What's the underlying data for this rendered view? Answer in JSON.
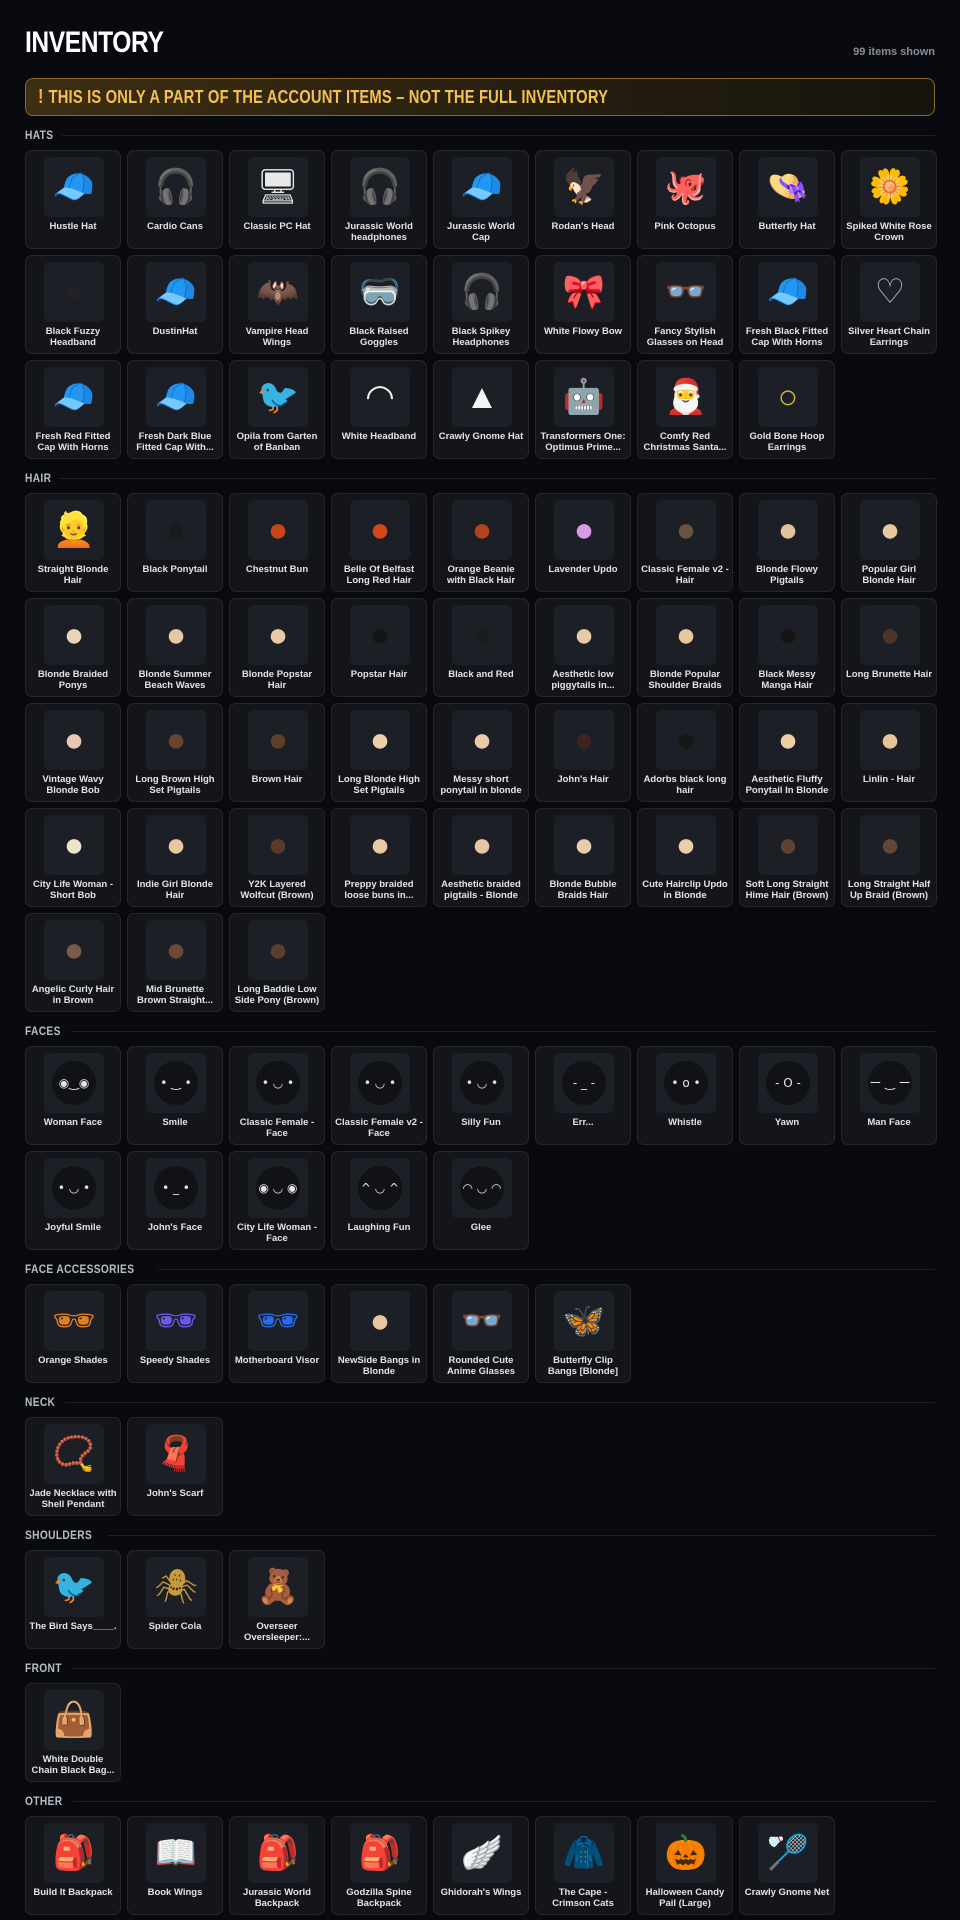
{
  "header": {
    "title": "INVENTORY",
    "count": "99 items shown",
    "warning": "THIS IS ONLY A PART OF THE ACCOUNT ITEMS – NOT THE FULL INVENTORY"
  },
  "colors": {
    "background": "#090a0f",
    "card": "#13151b",
    "accent": "#f4c04f"
  },
  "sections": [
    {
      "title": "HATS",
      "items": [
        {
          "label": "Hustle Hat",
          "glyph": "🧢",
          "color": "#2a2a2a"
        },
        {
          "label": "Cardio Cans",
          "glyph": "🎧",
          "color": "#9a32d6"
        },
        {
          "label": "Classic PC Hat",
          "glyph": "🖥",
          "color": "#e8e8e8"
        },
        {
          "label": "Jurassic World headphones",
          "glyph": "🎧",
          "color": "#3a3a3a"
        },
        {
          "label": "Jurassic World Cap",
          "glyph": "🧢",
          "color": "#2e2e2e"
        },
        {
          "label": "Rodan's Head",
          "glyph": "🦅",
          "color": "#6a1f2c"
        },
        {
          "label": "Pink Octopus",
          "glyph": "🐙",
          "color": "#f2a9c9"
        },
        {
          "label": "Butterfly Hat",
          "glyph": "👒",
          "color": "#f2f2f2"
        },
        {
          "label": "Spiked White Rose Crown",
          "glyph": "🌼",
          "color": "#f0f0f0"
        },
        {
          "label": "Black Fuzzy Headband",
          "glyph": "●",
          "color": "#222222"
        },
        {
          "label": "DustinHat",
          "glyph": "🧢",
          "color": "#e04444"
        },
        {
          "label": "Vampire Head Wings",
          "glyph": "🦇",
          "color": "#b32020"
        },
        {
          "label": "Black Raised Goggles",
          "glyph": "🥽",
          "color": "#2a2a2a"
        },
        {
          "label": "Black Spikey Headphones",
          "glyph": "🎧",
          "color": "#3a3a3a"
        },
        {
          "label": "White Flowy Bow",
          "glyph": "🎀",
          "color": "#f4f4f4"
        },
        {
          "label": "Fancy Stylish Glasses on Head",
          "glyph": "👓",
          "color": "#c8c8c8"
        },
        {
          "label": "Fresh Black Fitted Cap With Horns",
          "glyph": "🧢",
          "color": "#1e1e1e"
        },
        {
          "label": "Silver Heart Chain Earrings",
          "glyph": "♡",
          "color": "#b8b8b8"
        },
        {
          "label": "Fresh Red Fitted Cap With Horns",
          "glyph": "🧢",
          "color": "#d8293a"
        },
        {
          "label": "Fresh Dark Blue Fitted Cap With...",
          "glyph": "🧢",
          "color": "#1f2f7a"
        },
        {
          "label": "Opila from Garten of Banban",
          "glyph": "🐦",
          "color": "#d36ac2"
        },
        {
          "label": "White Headband",
          "glyph": "◠",
          "color": "#f0f0f0"
        },
        {
          "label": "Crawly Gnome Hat",
          "glyph": "▲",
          "color": "#f4f4f4"
        },
        {
          "label": "Transformers One: Optimus Prime...",
          "glyph": "🤖",
          "color": "#1f3c8f"
        },
        {
          "label": "Comfy Red Christmas Santa...",
          "glyph": "🎅",
          "color": "#d62b2b"
        },
        {
          "label": "Gold Bone Hoop Earrings",
          "glyph": "○",
          "color": "#d4ae3e"
        }
      ]
    },
    {
      "title": "HAIR",
      "items": [
        {
          "label": "Straight Blonde Hair",
          "glyph": "👱",
          "color": "#d8b33a"
        },
        {
          "label": "Black Ponytail",
          "glyph": "●",
          "color": "#1a1a1a"
        },
        {
          "label": "Chestnut Bun",
          "glyph": "●",
          "color": "#c9461a"
        },
        {
          "label": "Belle Of Belfast Long Red Hair",
          "glyph": "●",
          "color": "#d6461c"
        },
        {
          "label": "Orange Beanie with Black Hair",
          "glyph": "●",
          "color": "#b2441c"
        },
        {
          "label": "Lavender Updo",
          "glyph": "●",
          "color": "#d79ce8"
        },
        {
          "label": "Classic Female v2 - Hair",
          "glyph": "●",
          "color": "#6a5240"
        },
        {
          "label": "Blonde Flowy Pigtails",
          "glyph": "●",
          "color": "#e2c29a"
        },
        {
          "label": "Popular Girl Blonde Hair",
          "glyph": "●",
          "color": "#e8c8a0"
        },
        {
          "label": "Blonde Braided Ponys",
          "glyph": "●",
          "color": "#ecd2b8"
        },
        {
          "label": "Blonde Summer Beach Waves",
          "glyph": "●",
          "color": "#e6c8a4"
        },
        {
          "label": "Blonde Popstar Hair",
          "glyph": "●",
          "color": "#e8c9a6"
        },
        {
          "label": "Popstar Hair",
          "glyph": "●",
          "color": "#141414"
        },
        {
          "label": "Black and Red",
          "glyph": "●",
          "color": "#1c1c1c"
        },
        {
          "label": "Aesthetic low piggytails in...",
          "glyph": "●",
          "color": "#e8cba6"
        },
        {
          "label": "Blonde Popular Shoulder Braids",
          "glyph": "●",
          "color": "#e6c7a0"
        },
        {
          "label": "Black Messy Manga Hair",
          "glyph": "●",
          "color": "#151515"
        },
        {
          "label": "Long Brunette Hair",
          "glyph": "●",
          "color": "#4e3426"
        },
        {
          "label": "Vintage Wavy Blonde Bob",
          "glyph": "●",
          "color": "#e8c8b0"
        },
        {
          "label": "Long Brown High Set Pigtails",
          "glyph": "●",
          "color": "#6a4632"
        },
        {
          "label": "Brown Hair",
          "glyph": "●",
          "color": "#5c4024"
        },
        {
          "label": "Long Blonde High Set Pigtails",
          "glyph": "●",
          "color": "#ecd0a8"
        },
        {
          "label": "Messy short ponytail in blonde",
          "glyph": "●",
          "color": "#e8cca8"
        },
        {
          "label": "John's Hair",
          "glyph": "●",
          "color": "#3e241c"
        },
        {
          "label": "Adorbs black long hair",
          "glyph": "●",
          "color": "#161616"
        },
        {
          "label": "Aesthetic Fluffy Ponytail In Blonde",
          "glyph": "●",
          "color": "#ecd0a4"
        },
        {
          "label": "Linlin - Hair",
          "glyph": "●",
          "color": "#e8c49c"
        },
        {
          "label": "City Life Woman - Short Bob",
          "glyph": "●",
          "color": "#eee2c8"
        },
        {
          "label": "Indie Girl Blonde Hair",
          "glyph": "●",
          "color": "#e8c6a2"
        },
        {
          "label": "Y2K Layered Wolfcut (Brown)",
          "glyph": "●",
          "color": "#5a3a2a"
        },
        {
          "label": "Preppy braided loose buns in...",
          "glyph": "●",
          "color": "#e8c8a6"
        },
        {
          "label": "Aesthetic braided pigtails - Blonde",
          "glyph": "●",
          "color": "#e6c6a2"
        },
        {
          "label": "Blonde Bubble Braids Hair",
          "glyph": "●",
          "color": "#e8ccac"
        },
        {
          "label": "Cute Hairclip Updo in Blonde",
          "glyph": "●",
          "color": "#ecccaa"
        },
        {
          "label": "Soft Long Straight Hime Hair (Brown)",
          "glyph": "●",
          "color": "#5e4232"
        },
        {
          "label": "Long Straight Half Up Braid (Brown)",
          "glyph": "●",
          "color": "#624636"
        },
        {
          "label": "Angelic Curly Hair in Brown",
          "glyph": "●",
          "color": "#7a5a48"
        },
        {
          "label": "Mid Brunette Brown Straight...",
          "glyph": "●",
          "color": "#6a4a36"
        },
        {
          "label": "Long Baddie Low Side Pony (Brown)",
          "glyph": "●",
          "color": "#5c3e2e"
        }
      ]
    },
    {
      "title": "FACES",
      "items": [
        {
          "label": "Woman Face",
          "glyph": "◉‿◉",
          "color": "#e8e8e8"
        },
        {
          "label": "Smile",
          "glyph": "• ‿ •",
          "color": "#e8e8e8"
        },
        {
          "label": "Classic Female - Face",
          "glyph": "• ◡ •",
          "color": "#e8e8e8"
        },
        {
          "label": "Classic Female v2 - Face",
          "glyph": "• ◡ •",
          "color": "#e8e8e8"
        },
        {
          "label": "Silly Fun",
          "glyph": "• ◡ •",
          "color": "#e8e8e8"
        },
        {
          "label": "Err...",
          "glyph": "- _ -",
          "color": "#e8e8e8"
        },
        {
          "label": "Whistle",
          "glyph": "• o •",
          "color": "#e8e8e8"
        },
        {
          "label": "Yawn",
          "glyph": "- O -",
          "color": "#e8e8e8"
        },
        {
          "label": "Man Face",
          "glyph": "ー ‿ ー",
          "color": "#e8e8e8"
        },
        {
          "label": "Joyful Smile",
          "glyph": "• ◡ •",
          "color": "#e8e8e8"
        },
        {
          "label": "John's Face",
          "glyph": "• _ •",
          "color": "#e8e8e8"
        },
        {
          "label": "City Life Woman - Face",
          "glyph": "◉ ◡ ◉",
          "color": "#e8e8e8"
        },
        {
          "label": "Laughing Fun",
          "glyph": "^ ◡ ^",
          "color": "#e8e8e8"
        },
        {
          "label": "Glee",
          "glyph": "◠ ◡ ◠",
          "color": "#e8e8e8"
        }
      ]
    },
    {
      "title": "FACE ACCESSORIES",
      "items": [
        {
          "label": "Orange Shades",
          "glyph": "🕶",
          "color": "#e08020"
        },
        {
          "label": "Speedy Shades",
          "glyph": "🕶",
          "color": "#6a5ae8"
        },
        {
          "label": "Motherboard Visor",
          "glyph": "🕶",
          "color": "#2a6ae8"
        },
        {
          "label": "NewSide Bangs in Blonde",
          "glyph": "●",
          "color": "#e8c6a2"
        },
        {
          "label": "Rounded Cute Anime Glasses",
          "glyph": "👓",
          "color": "#cfcfcf"
        },
        {
          "label": "Butterfly Clip Bangs [Blonde]",
          "glyph": "🦋",
          "color": "#e6a8c8"
        }
      ]
    },
    {
      "title": "NECK",
      "items": [
        {
          "label": "Jade Necklace with Shell Pendant",
          "glyph": "📿",
          "color": "#2a8a5a"
        },
        {
          "label": "John's Scarf",
          "glyph": "🧣",
          "color": "#1e3a2e"
        }
      ]
    },
    {
      "title": "SHOULDERS",
      "items": [
        {
          "label": "The Bird Says____.",
          "glyph": "🐦",
          "color": "#2aa8e8"
        },
        {
          "label": "Spider Cola",
          "glyph": "🕷",
          "color": "#c89a3a"
        },
        {
          "label": "Overseer Oversleeper:...",
          "glyph": "🧸",
          "color": "#2a8a2a"
        }
      ]
    },
    {
      "title": "FRONT",
      "items": [
        {
          "label": "White Double Chain Black Bag...",
          "glyph": "👜",
          "color": "#f0f0f0"
        }
      ]
    },
    {
      "title": "OTHER",
      "items": [
        {
          "label": "Build It Backpack",
          "glyph": "🎒",
          "color": "#2a2a3a"
        },
        {
          "label": "Book Wings",
          "glyph": "📖",
          "color": "#e2d6b6"
        },
        {
          "label": "Jurassic World Backpack",
          "glyph": "🎒",
          "color": "#2a2a2a"
        },
        {
          "label": "Godzilla Spine Backpack",
          "glyph": "🎒",
          "color": "#1a6ab8"
        },
        {
          "label": "Ghidorah's Wings",
          "glyph": "🪽",
          "color": "#b8a030"
        },
        {
          "label": "The Cape - Crimson Cats",
          "glyph": "🧥",
          "color": "#d62b3a"
        },
        {
          "label": "Halloween Candy Pail (Large)",
          "glyph": "🎃",
          "color": "#e06a1a"
        },
        {
          "label": "Crawly Gnome Net",
          "glyph": "🏸",
          "color": "#d65a8a"
        }
      ]
    }
  ]
}
